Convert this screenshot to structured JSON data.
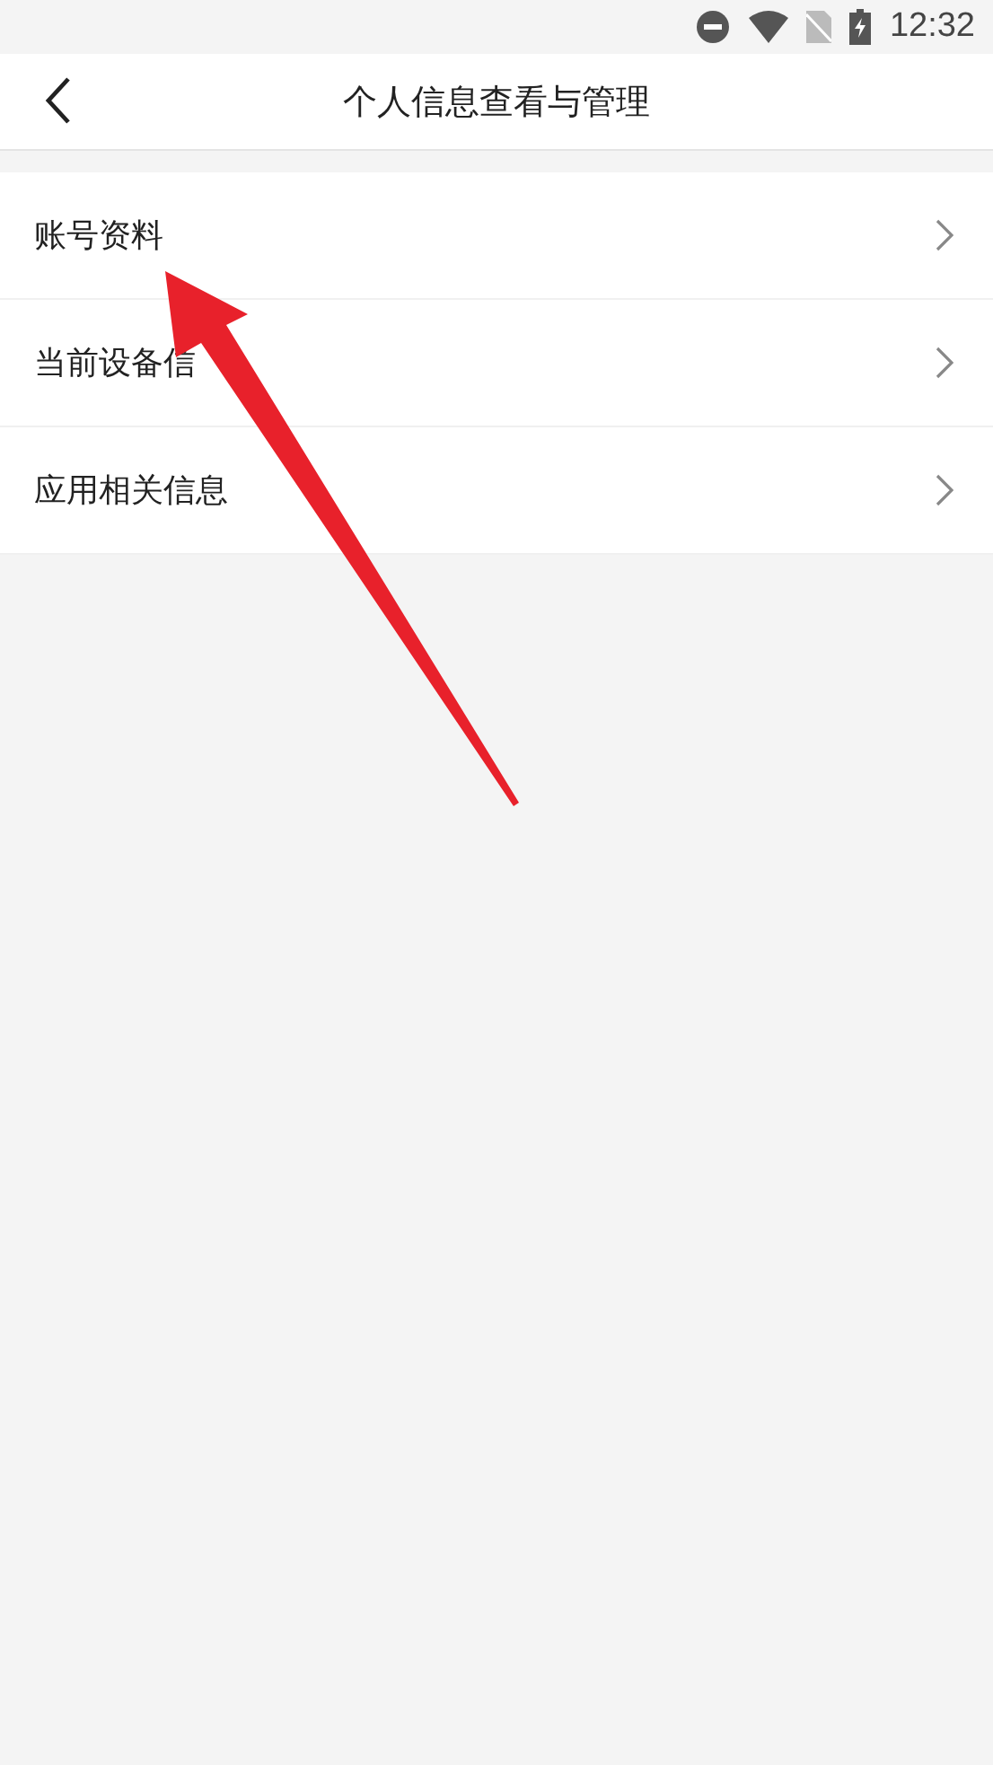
{
  "status_bar": {
    "time": "12:32"
  },
  "header": {
    "title": "个人信息查看与管理"
  },
  "menu": [
    {
      "label": "账号资料"
    },
    {
      "label": "当前设备信"
    },
    {
      "label": "应用相关信息"
    }
  ]
}
